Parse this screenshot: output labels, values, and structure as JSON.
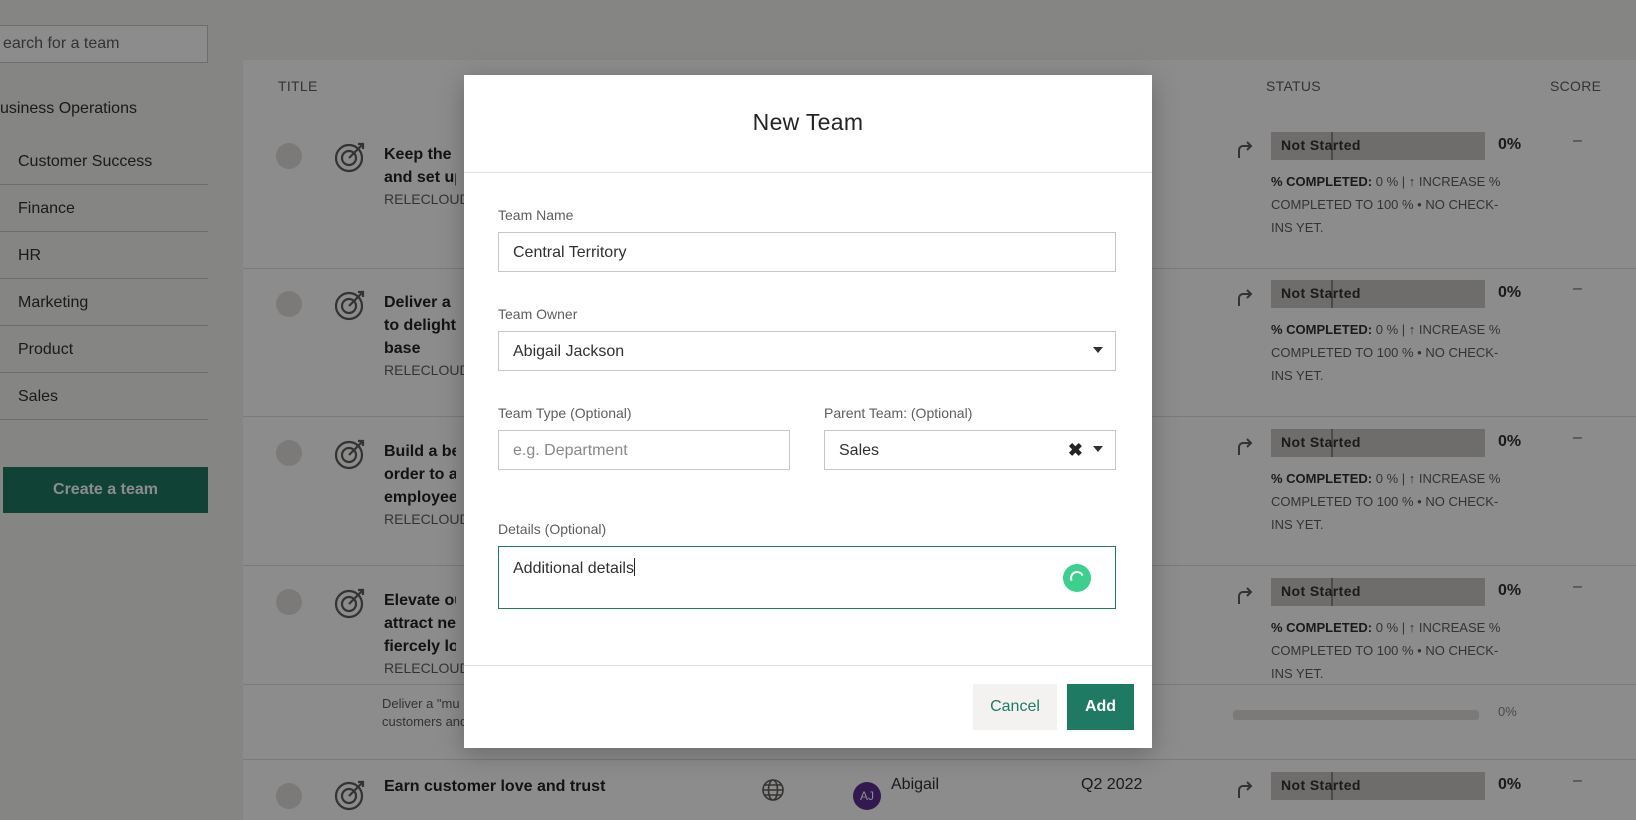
{
  "sidebar": {
    "search_placeholder": "earch for a team",
    "group_header": "usiness Operations",
    "items": [
      {
        "label": "Customer Success"
      },
      {
        "label": "Finance"
      },
      {
        "label": "HR"
      },
      {
        "label": "Marketing"
      },
      {
        "label": "Product"
      },
      {
        "label": "Sales"
      }
    ],
    "create_button": "Create a team"
  },
  "table": {
    "columns": {
      "title": "TITLE",
      "status": "STATUS",
      "score": "SCORE"
    },
    "rows": [
      {
        "title": "Keep the c\nand set up",
        "org": "RELECLOUD",
        "status": "Not Started",
        "pct": "0%",
        "score": "–"
      },
      {
        "title": "Deliver a \"\nto delight \nbase",
        "org": "RELECLOUD",
        "status": "Not Started",
        "pct": "0%",
        "score": "–"
      },
      {
        "title": "Build a bes\norder to at\nemployees",
        "org": "RELECLOUD",
        "status": "Not Started",
        "pct": "0%",
        "score": "–"
      },
      {
        "title": "Elevate our\nattract new\nfiercely loy",
        "org": "RELECLOUD",
        "status": "Not Started",
        "pct": "0%",
        "score": "–"
      }
    ],
    "desc_prefix": "% COMPLETED:",
    "desc_rest": "0 % | ↑ INCREASE % COMPLETED TO 100 % • NO CHECK-INS YET.",
    "mini_row": {
      "title": "Deliver a \"mu\ncustomers and grow our user base",
      "pct": "0%"
    },
    "last_row": {
      "title": "Earn customer love and trust",
      "owner": "Abigail",
      "avatar": "AJ",
      "quarter": "Q2 2022",
      "status": "Not Started",
      "pct": "0%",
      "score": "–"
    }
  },
  "modal": {
    "title": "New Team",
    "team_name_label": "Team Name",
    "team_name_value": "Central Territory",
    "team_owner_label": "Team Owner",
    "team_owner_value": "Abigail Jackson",
    "team_type_label": "Team Type (Optional)",
    "team_type_placeholder": "e.g. Department",
    "parent_team_label": "Parent Team: (Optional)",
    "parent_team_value": "Sales",
    "details_label": "Details (Optional)",
    "details_value": "Additional details",
    "cancel_label": "Cancel",
    "add_label": "Add"
  },
  "colors": {
    "accent": "#1e7a63",
    "spinner": "#3ccf8e",
    "overlay": "rgba(0,0,0,0.45)"
  }
}
